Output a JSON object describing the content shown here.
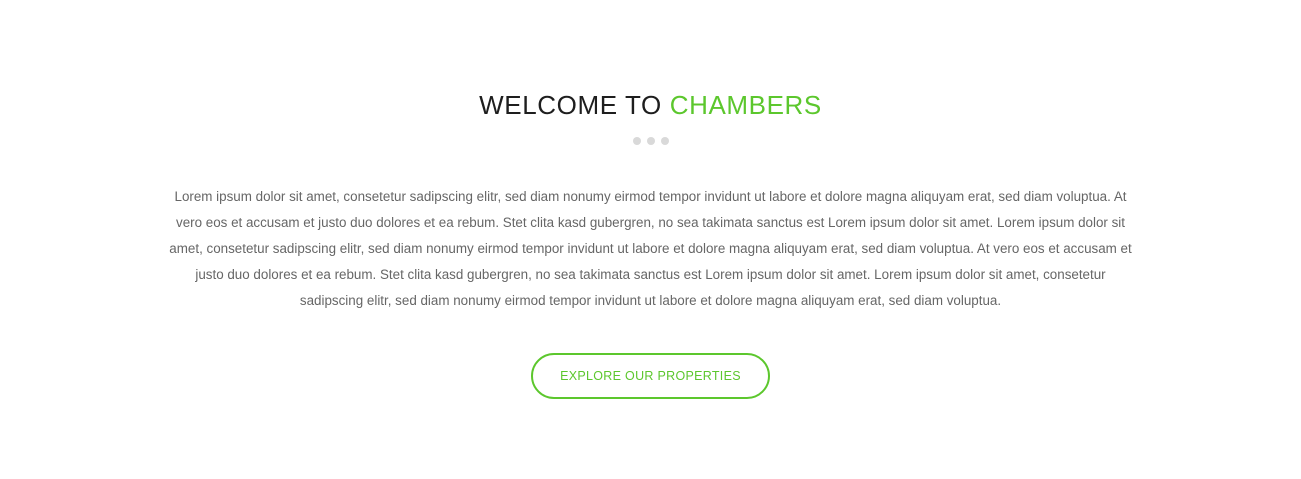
{
  "welcome": {
    "title_prefix": "WELCOME TO ",
    "title_accent": "CHAMBERS",
    "body": "Lorem ipsum dolor sit amet, consetetur sadipscing elitr, sed diam nonumy eirmod tempor invidunt ut labore et dolore magna aliquyam erat, sed diam voluptua. At vero eos et accusam et justo duo dolores et ea rebum. Stet clita kasd gubergren, no sea takimata sanctus est Lorem ipsum dolor sit amet. Lorem ipsum dolor sit amet, consetetur sadipscing elitr, sed diam nonumy eirmod tempor invidunt ut labore et dolore magna aliquyam erat, sed diam voluptua. At vero eos et accusam et justo duo dolores et ea rebum. Stet clita kasd gubergren, no sea takimata sanctus est Lorem ipsum dolor sit amet. Lorem ipsum dolor sit amet, consetetur sadipscing elitr, sed diam nonumy eirmod tempor invidunt ut labore et dolore magna aliquyam erat, sed diam voluptua.",
    "button_label": "EXPLORE OUR PROPERTIES"
  },
  "colors": {
    "accent": "#5cc72d",
    "heading": "#1e1e1e",
    "body_text": "#666666",
    "divider_dots": "#d9d9d9"
  }
}
